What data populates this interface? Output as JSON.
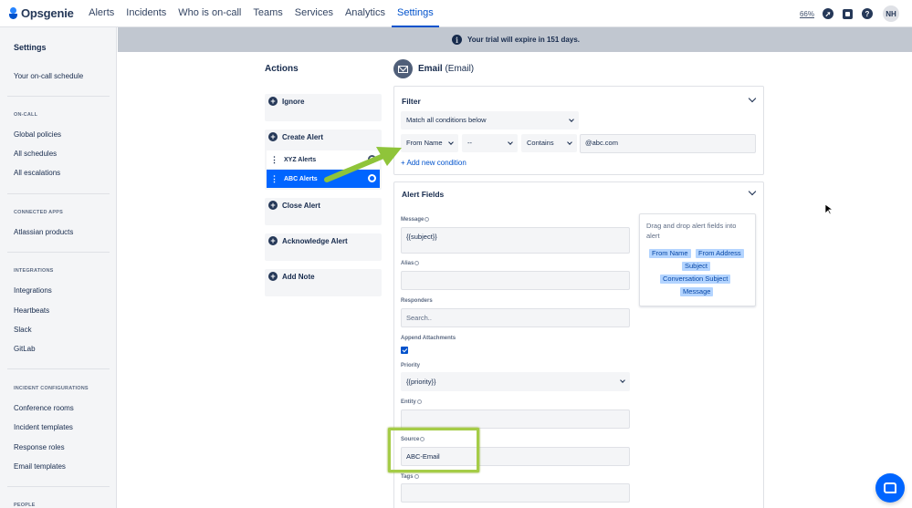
{
  "brand": {
    "name": "Opsgenie"
  },
  "nav": {
    "items": [
      {
        "label": "Alerts",
        "active": false
      },
      {
        "label": "Incidents",
        "active": false
      },
      {
        "label": "Who is on-call",
        "active": false
      },
      {
        "label": "Teams",
        "active": false
      },
      {
        "label": "Services",
        "active": false
      },
      {
        "label": "Analytics",
        "active": false
      },
      {
        "label": "Settings",
        "active": true
      }
    ],
    "zoom": "66%",
    "icons": [
      "rocket-icon",
      "notebook-icon",
      "help-icon"
    ],
    "user_initials": "NH"
  },
  "banner": {
    "text": "Your trial will expire in 151 days."
  },
  "sidebar": {
    "title": "Settings",
    "top_link": "Your on-call schedule",
    "sections": [
      {
        "heading": "ON-CALL",
        "items": [
          "Global policies",
          "All schedules",
          "All escalations"
        ]
      },
      {
        "heading": "CONNECTED APPS",
        "items": [
          "Atlassian products"
        ]
      },
      {
        "heading": "INTEGRATIONS",
        "items": [
          "Integrations",
          "Heartbeats",
          "Slack",
          "GitLab"
        ]
      },
      {
        "heading": "INCIDENT CONFIGURATIONS",
        "items": [
          "Conference rooms",
          "Incident templates",
          "Response roles",
          "Email templates"
        ]
      },
      {
        "heading": "PEOPLE",
        "items": []
      }
    ]
  },
  "actions": {
    "title": "Actions",
    "ignore": "Ignore",
    "create_alert": "Create Alert",
    "rules": [
      {
        "label": "XYZ Alerts",
        "selected": false
      },
      {
        "label": "ABC Alerts",
        "selected": true
      }
    ],
    "close_alert": "Close Alert",
    "acknowledge_alert": "Acknowledge Alert",
    "add_note": "Add Note"
  },
  "integration": {
    "name": "Email",
    "type": "(Email)"
  },
  "filter": {
    "title": "Filter",
    "match_mode": "Match all conditions below",
    "condition": {
      "field": "From Name",
      "not": "--",
      "operation": "Contains",
      "value": "@abc.com"
    },
    "add_condition": "+ Add new condition"
  },
  "alert_fields": {
    "title": "Alert Fields",
    "message_label": "Message",
    "message_value": "{{subject}}",
    "alias_label": "Alias",
    "alias_value": "",
    "responders_label": "Responders",
    "responders_placeholder": "Search..",
    "append_attachments_label": "Append Attachments",
    "append_attachments_checked": true,
    "priority_label": "Priority",
    "priority_value": "{{priority}}",
    "entity_label": "Entity",
    "entity_value": "",
    "source_label": "Source",
    "source_value": "ABC-Email",
    "tags_label": "Tags",
    "tags_value": "",
    "drag_hint": "Drag and drop alert fields into alert",
    "chips": [
      "From Name",
      "From Address",
      "Subject",
      "Conversation Subject",
      "Message"
    ]
  },
  "colors": {
    "primary": "#0052cc",
    "selected_rule": "#0065ff",
    "highlight": "#a5cc47",
    "annotation_arrow": "#8fc43a",
    "banner": "#c1c7d0"
  }
}
